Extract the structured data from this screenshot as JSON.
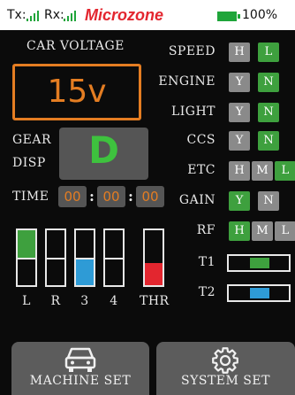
{
  "status": {
    "tx_label": "Tx:",
    "rx_label": "Rx:",
    "brand": "Microzone",
    "battery": "100%",
    "tx_signal_bars": 4,
    "rx_signal_bars": 4
  },
  "voltage": {
    "label": "CAR VOLTAGE",
    "value": "15v",
    "color": "#e47d22"
  },
  "gear": {
    "label_line1": "GEAR",
    "label_line2": "DISP",
    "value": "D",
    "color": "#3ec23e"
  },
  "time": {
    "label": "TIME",
    "hh": "00",
    "mm": "00",
    "ss": "00",
    "separator": ":"
  },
  "gauges": [
    {
      "label": "L",
      "level": 0.5,
      "color": "#3ea03e"
    },
    {
      "label": "R",
      "level": 0,
      "color": "#3ea03e"
    },
    {
      "label": "3",
      "level": 0.5,
      "color": "#2e9bd6"
    },
    {
      "label": "4",
      "level": 0,
      "color": "#3ea03e"
    },
    {
      "label": "THR",
      "level": 0.4,
      "color": "#e3262f"
    }
  ],
  "settings": {
    "speed": {
      "label": "SPEED",
      "options": [
        "H",
        "L"
      ],
      "selected": "L"
    },
    "engine": {
      "label": "ENGINE",
      "options": [
        "Y",
        "N"
      ],
      "selected": "N"
    },
    "light": {
      "label": "LIGHT",
      "options": [
        "Y",
        "N"
      ],
      "selected": "N"
    },
    "ccs": {
      "label": "CCS",
      "options": [
        "Y",
        "N"
      ],
      "selected": "N"
    },
    "etc": {
      "label": "ETC",
      "options": [
        "H",
        "M",
        "L"
      ],
      "selected": "L"
    },
    "gain": {
      "label": "GAIN",
      "options": [
        "Y",
        "N"
      ],
      "selected": "Y"
    },
    "rf": {
      "label": "RF",
      "options": [
        "H",
        "M",
        "L"
      ],
      "selected": "H"
    }
  },
  "trims": {
    "t1": {
      "label": "T1",
      "color": "#3ea03e"
    },
    "t2": {
      "label": "T2",
      "color": "#2e9bd6"
    }
  },
  "buttons": {
    "machine_set": "MACHINE SET",
    "system_set": "SYSTEM SET"
  },
  "colors": {
    "accent": "#e47d22",
    "on": "#3ea03e",
    "off": "#8a8a8a",
    "panel": "#555555"
  },
  "icons": {
    "machine": "car-icon",
    "system": "gear-icon"
  }
}
